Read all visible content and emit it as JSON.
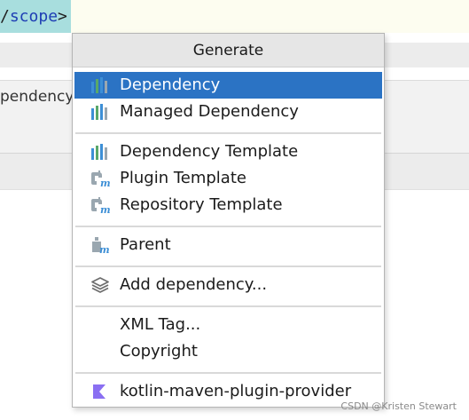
{
  "editor": {
    "code_slash": "/",
    "code_tag": "scope",
    "code_gt": ">",
    "panel_text": "pendency"
  },
  "popup": {
    "title": "Generate",
    "items": [
      {
        "label": "Dependency",
        "icon": "maven-bars-icon",
        "selected": true
      },
      {
        "label": "Managed Dependency",
        "icon": "maven-bars-icon",
        "selected": false
      },
      {
        "label": "Dependency Template",
        "icon": "maven-bars-icon",
        "selected": false
      },
      {
        "label": "Plugin Template",
        "icon": "maven-plugin-icon",
        "selected": false
      },
      {
        "label": "Repository Template",
        "icon": "maven-plugin-icon",
        "selected": false
      },
      {
        "label": "Parent",
        "icon": "maven-parent-icon",
        "selected": false
      },
      {
        "label": "Add dependency...",
        "icon": "layers-icon",
        "selected": false
      },
      {
        "label": "XML Tag...",
        "icon": "",
        "selected": false
      },
      {
        "label": "Copyright",
        "icon": "",
        "selected": false
      },
      {
        "label": "kotlin-maven-plugin-provider",
        "icon": "kotlin-icon",
        "selected": false
      }
    ]
  },
  "watermark": "CSDN @Kristen Stewart",
  "colors": {
    "selection": "#2b73c4",
    "maven_blue": "#3d8fd6",
    "maven_green": "#59a869",
    "kotlin_purple": "#8a6ff2"
  }
}
